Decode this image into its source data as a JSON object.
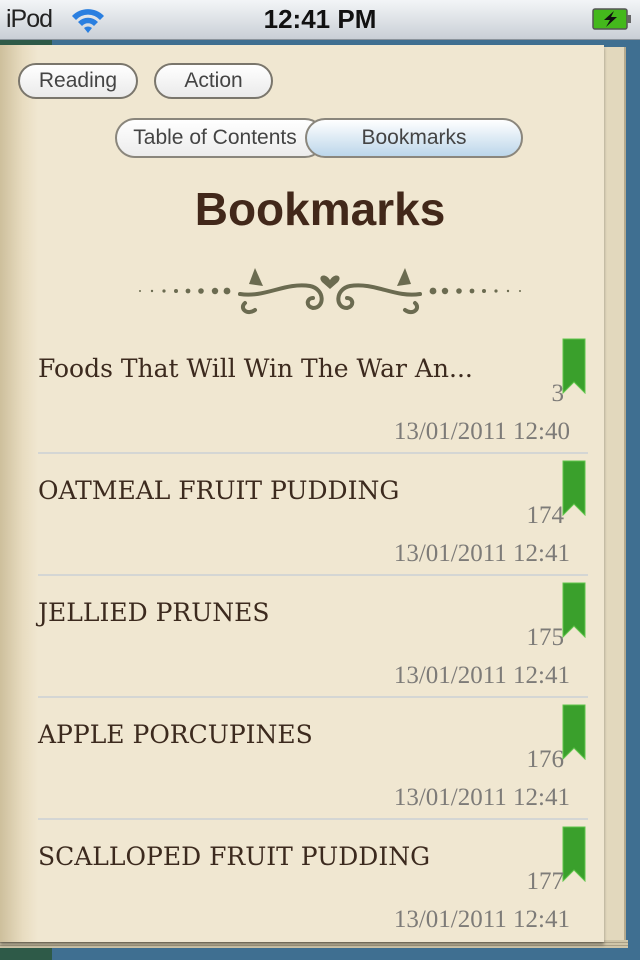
{
  "status_bar": {
    "carrier": "iPod",
    "time": "12:41 PM",
    "wifi_icon": "wifi-icon",
    "battery_icon": "battery-charging-icon"
  },
  "toolbar": {
    "reading_label": "Reading",
    "action_label": "Action"
  },
  "segments": [
    {
      "label": "Table of Contents",
      "selected": false
    },
    {
      "label": "Bookmarks",
      "selected": true
    }
  ],
  "page_title": "Bookmarks",
  "colors": {
    "bookmark_flag": "#3aa02c",
    "paper": "#f0e7d1",
    "title_text": "#42281a",
    "meta_text": "#7d7b78",
    "selected_segment": "#bcd6ea"
  },
  "bookmarks": [
    {
      "title": "Foods That Will Win The War An...",
      "page": "3",
      "date": "13/01/2011 12:40"
    },
    {
      "title": "OATMEAL FRUIT PUDDING",
      "page": "174",
      "date": "13/01/2011 12:41"
    },
    {
      "title": "JELLIED PRUNES",
      "page": "175",
      "date": "13/01/2011 12:41"
    },
    {
      "title": "APPLE PORCUPINES",
      "page": "176",
      "date": "13/01/2011 12:41"
    },
    {
      "title": "SCALLOPED FRUIT PUDDING",
      "page": "177",
      "date": "13/01/2011 12:41"
    }
  ]
}
